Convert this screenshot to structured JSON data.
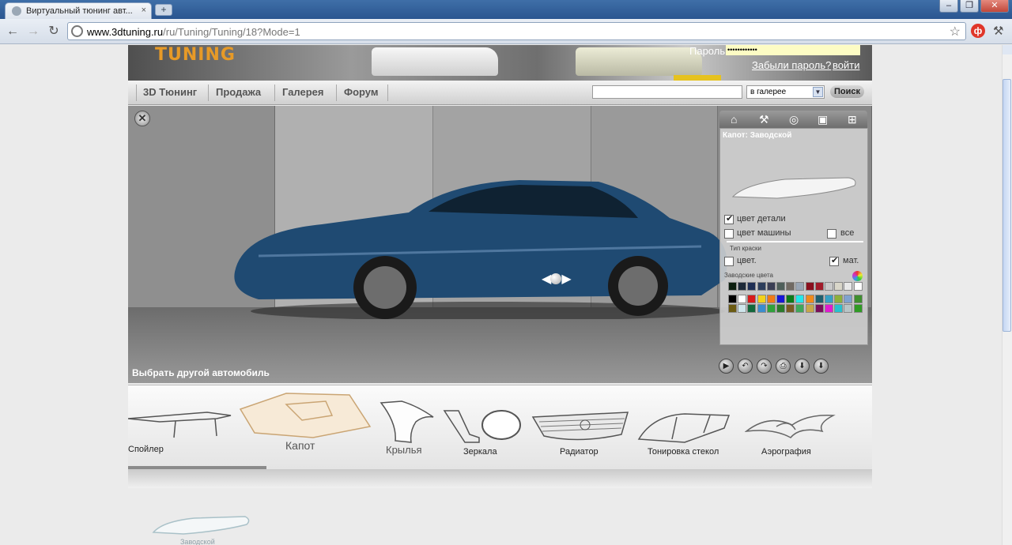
{
  "browser": {
    "tab_title": "Виртуальный тюнинг авт...",
    "tab_close": "×",
    "new_tab": "+",
    "url_host": "www.3dtuning.ru",
    "url_path": "/ru/Tuning/Tuning/18?Mode=1",
    "extension_letter": "ф",
    "window_buttons": {
      "minimize": "–",
      "maximize": "❐",
      "close": "✕"
    }
  },
  "header": {
    "logo": "TUNING",
    "password_label": "Пароль",
    "password_value": "••••••••••••",
    "forgot_link": "Забыли пароль?",
    "login_link": "войти"
  },
  "menu": {
    "items": [
      "3D Тюнинг",
      "Продажа",
      "Галерея",
      "Форум"
    ],
    "search_placeholder": "",
    "search_scope": "в галерее",
    "search_button": "Поиск"
  },
  "stage": {
    "close_icon": "close-icon",
    "rotate_left": "◀",
    "rotate_right": "▶",
    "choose_car": "Выбрать другой автомобиль"
  },
  "panel": {
    "tools": [
      "home-icon",
      "tools-icon",
      "rims-icon",
      "camera-icon",
      "tree-icon"
    ],
    "part_title": "Капот: Заводской",
    "part_color_label": "цвет детали",
    "car_color_label": "цвет машины",
    "all_label": "все",
    "paint_type_label": "Тип краски",
    "gloss_label": "цвет.",
    "matte_label": "мат.",
    "factory_colors_label": "Заводские цвета",
    "part_color_checked": true,
    "car_color_checked": false,
    "all_checked": false,
    "gloss_checked": false,
    "matte_checked": true,
    "swatch_colors": [
      [
        "#0c1f0f",
        "#1e2a39",
        "#1f2f55",
        "#2d3e5c",
        "#3b3f55",
        "#4f5f5a",
        "#716a63",
        "#9aa6b5",
        "#8a0f1e",
        "#a11b2a",
        "#c9c9c9",
        "#d9d6c9",
        "#e8e8e8",
        "#ffffff"
      ],
      [
        "#000000",
        "#ffffff",
        "#d81b1b",
        "#f3d11b",
        "#f07a16",
        "#1616d6",
        "#0c7a18",
        "#25e7e7",
        "#f08a1a",
        "#1e5f6e",
        "#36a0c4",
        "#8db03b",
        "#7fa2cf",
        "#3f8f2f"
      ],
      [
        "#6b5b12",
        "#cfe6ec",
        "#12683b",
        "#3a8dcf",
        "#2fa23b",
        "#2b7a2b",
        "#7a5a22",
        "#3ea85a",
        "#c8a64a",
        "#7a0f5a",
        "#e11bd0",
        "#27c2cf",
        "#b8c5c7",
        "#2f9b24"
      ]
    ],
    "action_icons": [
      "play-icon",
      "undo-icon",
      "redo-icon",
      "print-icon",
      "save-icon",
      "download-icon"
    ]
  },
  "parts": [
    {
      "name": "spoiler",
      "label": "Спойлер"
    },
    {
      "name": "hood",
      "label": "Капот"
    },
    {
      "name": "fenders",
      "label": "Крылья"
    },
    {
      "name": "mirrors",
      "label": "Зеркала"
    },
    {
      "name": "grille",
      "label": "Радиатор"
    },
    {
      "name": "tint",
      "label": "Тонировка стекол"
    },
    {
      "name": "airbrush",
      "label": "Аэрография"
    }
  ],
  "variant": {
    "label": "Заводской"
  }
}
